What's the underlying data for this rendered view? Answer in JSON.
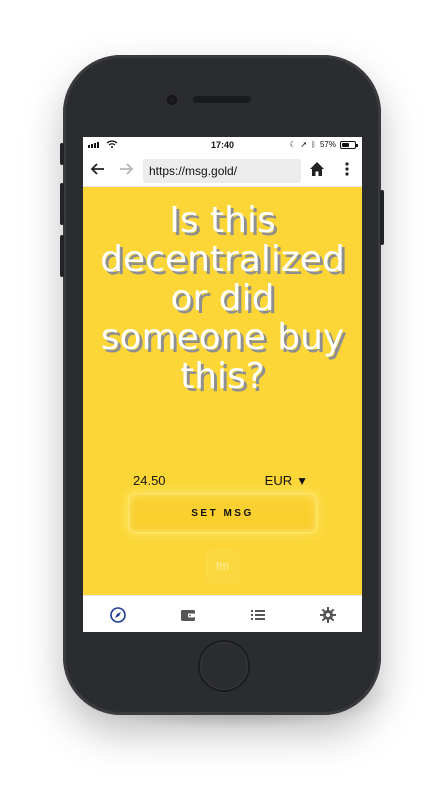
{
  "status_bar": {
    "time": "17:40",
    "battery_text": "57%",
    "battery_level_percent": 57,
    "icons": [
      "signal-icon",
      "wifi-icon",
      "moon-icon",
      "location-icon",
      "bluetooth-icon",
      "battery-icon"
    ]
  },
  "browser": {
    "url": "https://msg.gold/",
    "icons": [
      "back-arrow-icon",
      "forward-arrow-icon",
      "home-icon",
      "more-vert-icon"
    ]
  },
  "page": {
    "headline": "Is this decentralized or did someone buy this?",
    "amount": "24.50",
    "currency": "EUR",
    "currency_arrow": "▼",
    "set_button_label": "SET MSG",
    "logo_text": "fm",
    "background_color": "#fbd636"
  },
  "tabbar": {
    "tabs": [
      {
        "icon": "compass-icon",
        "active": true,
        "color": "#1f3a93"
      },
      {
        "icon": "wallet-icon",
        "active": false
      },
      {
        "icon": "list-icon",
        "active": false
      },
      {
        "icon": "gear-icon",
        "active": false
      }
    ]
  }
}
